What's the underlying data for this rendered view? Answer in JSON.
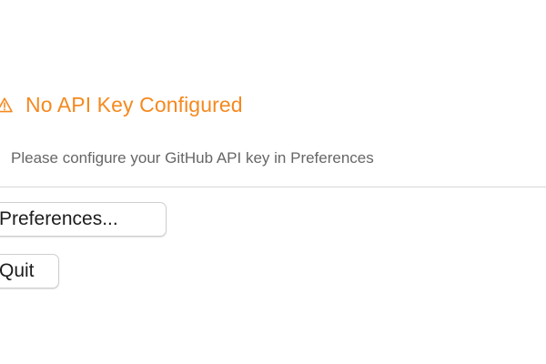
{
  "alert": {
    "icon": "warning-icon",
    "title": "No API Key Configured",
    "message": "Please configure your GitHub API key in Preferences",
    "accent_color": "#f5891f"
  },
  "actions": {
    "preferences_label": "Preferences...",
    "quit_label": "Quit"
  }
}
